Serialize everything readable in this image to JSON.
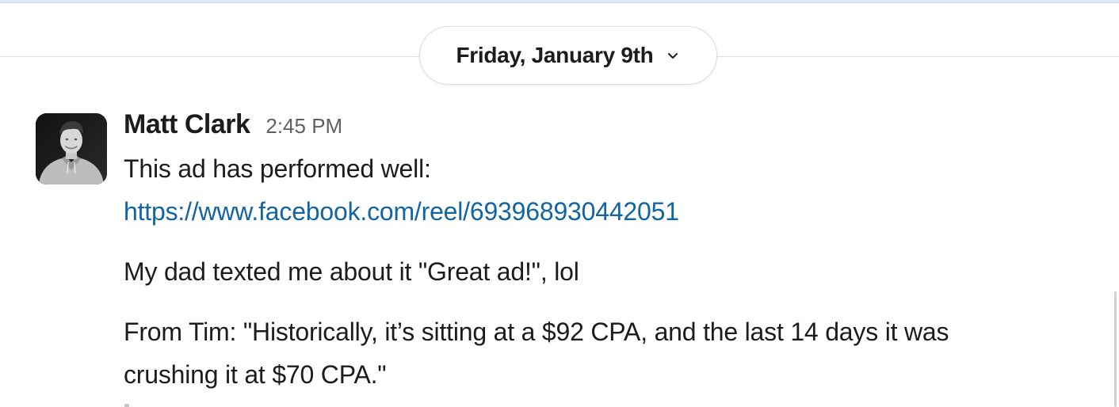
{
  "date_divider": {
    "label": "Friday, January 9th",
    "icon": "chevron-down-icon"
  },
  "message": {
    "author": "Matt Clark",
    "timestamp": "2:45 PM",
    "avatar_icon": "user-avatar-photo",
    "lines": {
      "intro": "This ad has performed well:",
      "link": "https://www.facebook.com/reel/693968930442051",
      "dad": "My dad texted me about it \"Great ad!\", lol",
      "tim_line1": "From Tim: \"Historically, it’s sitting at a $92 CPA, and the last 14 days it was",
      "tim_line2": "crushing it at $70 CPA.\""
    }
  },
  "colors": {
    "link": "#1264a3",
    "text": "#1d1c1d",
    "timestamp": "#616061",
    "divider": "#dddddd"
  }
}
